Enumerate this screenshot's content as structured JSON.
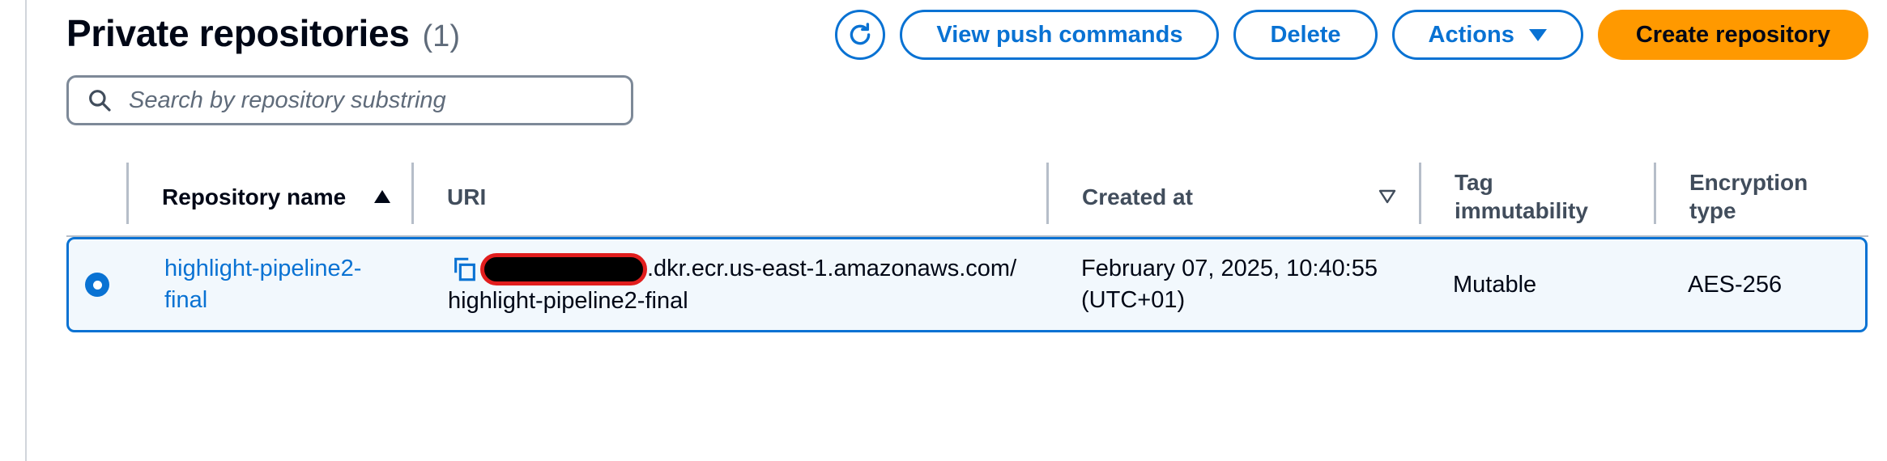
{
  "header": {
    "title": "Private repositories",
    "count": "(1)"
  },
  "toolbar": {
    "refresh_icon": "refresh-icon",
    "view_push_label": "View push commands",
    "delete_label": "Delete",
    "actions_label": "Actions",
    "create_label": "Create repository",
    "accent_color": "#0972d3",
    "primary_color": "#ff9900"
  },
  "search": {
    "placeholder": "Search by repository substring",
    "value": ""
  },
  "table": {
    "columns": {
      "name": "Repository name",
      "uri": "URI",
      "created": "Created at",
      "tag_line1": "Tag",
      "tag_line2": "immutability",
      "enc_line1": "Encryption",
      "enc_line2": "type"
    },
    "sort": {
      "name": "ascending",
      "created": "none"
    },
    "rows": [
      {
        "selected": true,
        "name_line1": "highlight-pipeline2-",
        "name_line2": "final",
        "uri_line1_suffix": ".dkr.ecr.us-east-1.amazonaws.com/",
        "uri_line2": "highlight-pipeline2-final",
        "created_line1": "February 07, 2025, 10:40:55",
        "created_line2": "(UTC+01)",
        "tag_immutability": "Mutable",
        "encryption": "AES-256"
      }
    ]
  }
}
